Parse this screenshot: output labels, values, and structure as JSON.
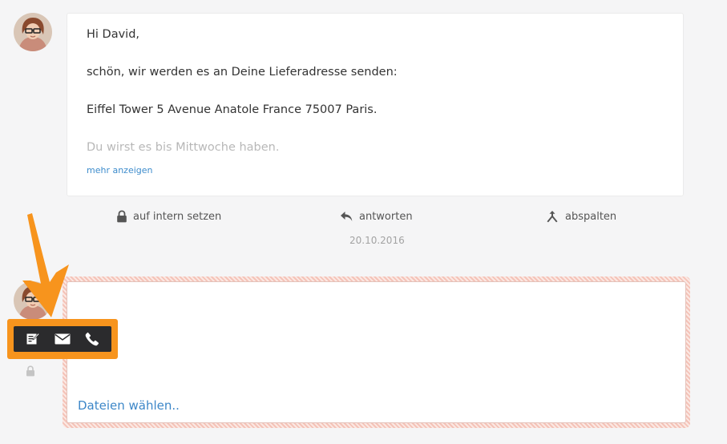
{
  "message": {
    "lines": [
      "Hi David,",
      "schön, wir werden es an Deine Lieferadresse senden:",
      "Eiffel Tower 5 Avenue Anatole France 75007 Paris.",
      "Du wirst es bis Mittwoche haben."
    ],
    "show_more": "mehr anzeigen"
  },
  "actions": {
    "internal": "auf intern setzen",
    "reply": "antworten",
    "split": "abspalten"
  },
  "timestamp": "20.10.2016",
  "composer": {
    "body": "",
    "file_chooser": "Dateien wählen.."
  },
  "type_switcher": {
    "icons": [
      "note-icon",
      "email-icon",
      "phone-icon"
    ]
  },
  "colors": {
    "accent_orange": "#f7941d",
    "link_blue": "#3d87c8",
    "switcher_bg": "#2b2b2d"
  }
}
